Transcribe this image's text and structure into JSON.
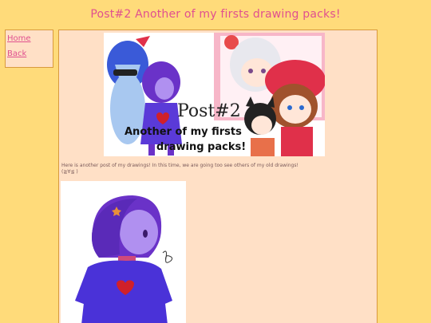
{
  "page": {
    "title": "Post#2 Another of my firsts drawing packs!"
  },
  "nav": {
    "home_label": "Home",
    "back_label": "Back"
  },
  "post": {
    "banner_title": "Post#2",
    "banner_subtitle_line1": "Another of my firsts",
    "banner_subtitle_line2": "drawing packs!",
    "body_text": "Here is another post of my drawings! In this time, we are going too see others of my old drawings!",
    "body_emote": "(≧∀≦ )"
  },
  "colors": {
    "background": "#ffdb7a",
    "panel": "#ffe0c6",
    "accent": "#e0508f",
    "border": "#d99a3e"
  }
}
